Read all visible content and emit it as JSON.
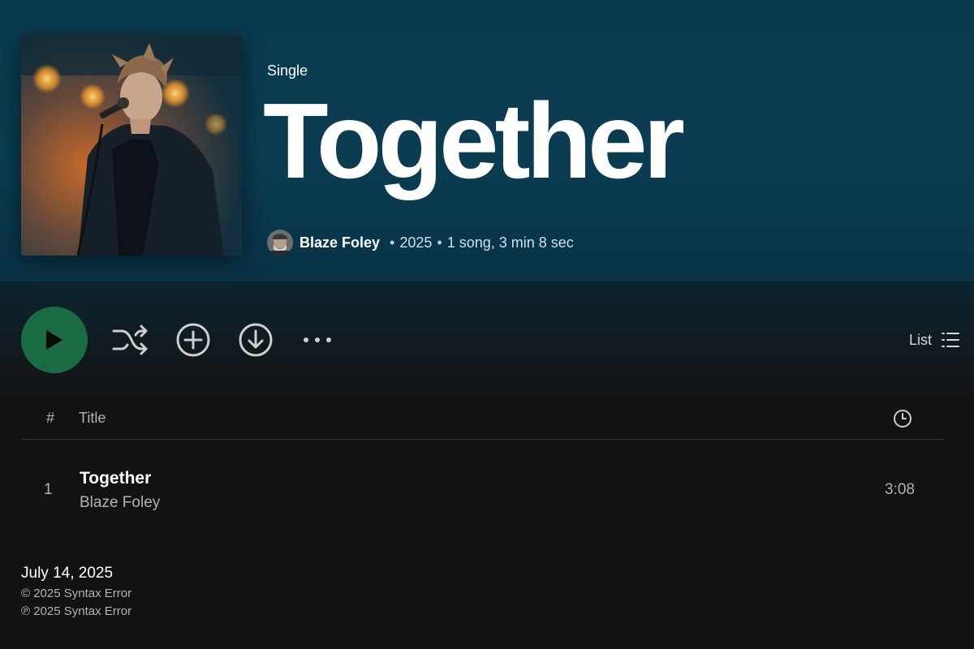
{
  "header": {
    "album_type": "Single",
    "title": "Together",
    "artist": "Blaze Foley",
    "year": "2025",
    "summary": "1 song, 3 min 8 sec",
    "separator": "•"
  },
  "actions": {
    "view_label": "List"
  },
  "tracklist": {
    "header_num": "#",
    "header_title": "Title",
    "tracks": [
      {
        "num": "1",
        "title": "Together",
        "artist": "Blaze Foley",
        "duration": "3:08"
      }
    ]
  },
  "footer": {
    "release_date": "July 14, 2025",
    "copyright_c": "© 2025 Syntax Error",
    "copyright_p": "℗ 2025 Syntax Error"
  },
  "colors": {
    "header_bg": "#0b3d52",
    "play_button": "#1a6b43",
    "background": "#121212"
  },
  "icons": [
    "play-icon",
    "shuffle-icon",
    "add-circle-icon",
    "download-icon",
    "more-icon",
    "list-view-icon",
    "clock-icon"
  ]
}
